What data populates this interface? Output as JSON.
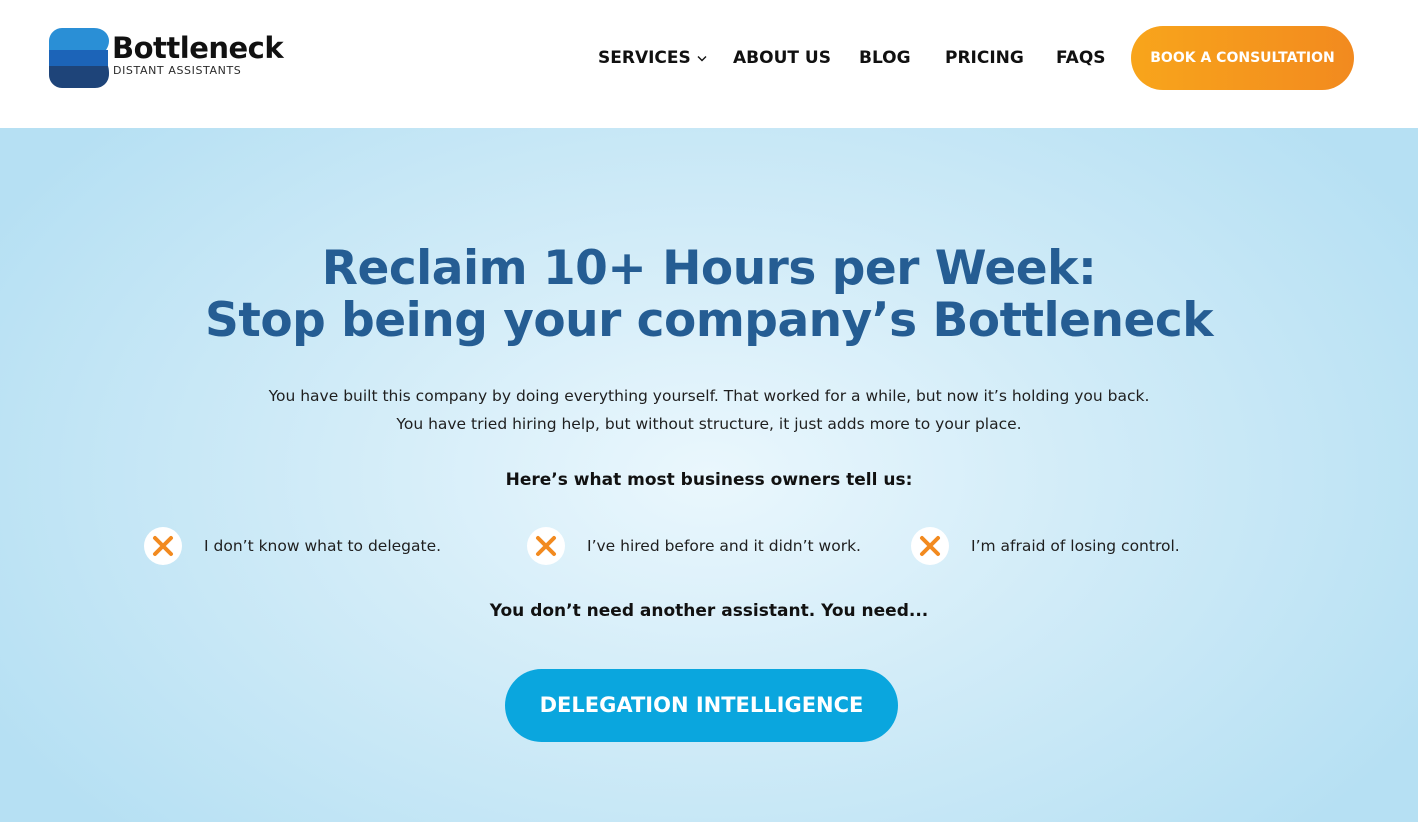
{
  "brand": {
    "name": "Bottleneck",
    "tagline": "DISTANT ASSISTANTS",
    "logo_icon": "stacked-b-logo-icon",
    "colors": {
      "logo_light": "#2a8fd6",
      "logo_mid": "#1c64b8",
      "logo_dark": "#1e4479"
    }
  },
  "nav": {
    "items": [
      {
        "label": "SERVICES",
        "has_dropdown": true
      },
      {
        "label": "ABOUT US"
      },
      {
        "label": "BLOG"
      },
      {
        "label": "PRICING"
      },
      {
        "label": "FAQS"
      }
    ],
    "dropdown_icon": "chevron-down-icon",
    "cta_label": "BOOK A CONSULTATION"
  },
  "hero": {
    "title_line1": "Reclaim 10+ Hours per Week:",
    "title_line2": "Stop being your company’s Bottleneck",
    "subtitle_line1": "You have built this company by doing everything yourself. That worked for a while, but now it’s holding you back.",
    "subtitle_line2": "You have tried hiring help, but without structure, it just adds more to your place.",
    "lead_in": "Here’s what most business owners tell us:",
    "pain_points": [
      {
        "icon": "x-mark-icon",
        "text": "I don’t know what to delegate."
      },
      {
        "icon": "x-mark-icon",
        "text": "I’ve hired before and it didn’t work."
      },
      {
        "icon": "x-mark-icon",
        "text": "I’m afraid of losing control."
      }
    ],
    "need_text": "You don’t need another assistant. You need...",
    "button_label": "DELEGATION INTELLIGENCE"
  },
  "colors": {
    "title": "#255d93",
    "cta_orange": "#f8a51b",
    "button_blue": "#0aa6de",
    "x_mark": "#f28a1f",
    "hero_background": "#cdeaf7"
  }
}
